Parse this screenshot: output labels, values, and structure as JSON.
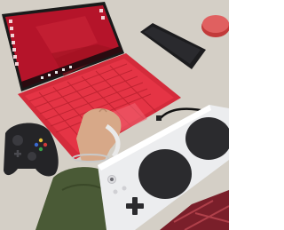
{
  "scene": {
    "kind": "photo",
    "colors": {
      "desk": "#d8d3ca",
      "laptop_screen": "#b5142a",
      "laptop_keyboard": "#e53445",
      "phone": "#1c1c1e",
      "compact": "#d94a4a",
      "xbox_controller": "#242427",
      "adaptive_controller": "#ecedef",
      "adaptive_buttons": "#2b2b2e",
      "sleeve": "#4a5a36"
    }
  }
}
